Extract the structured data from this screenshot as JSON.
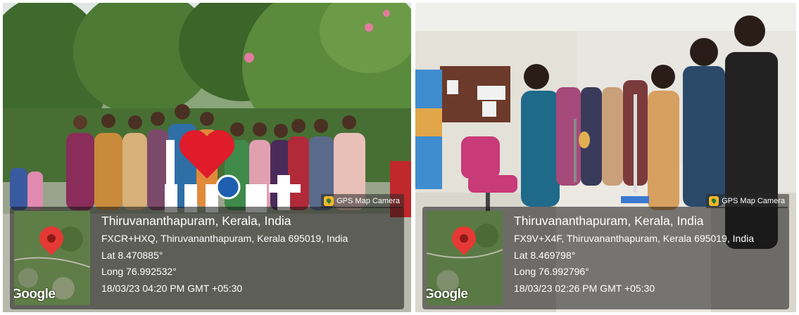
{
  "photos": [
    {
      "badge_label": "GPS Map Camera",
      "map_watermark": "Google",
      "location_title": "Thiruvananthapuram, Kerala, India",
      "address": "FXCR+HXQ, Thiruvananthapuram, Kerala 695019, India",
      "lat": "Lat 8.470885°",
      "long": "Long 76.992532°",
      "datetime": "18/03/23 04:20 PM GMT +05:30",
      "sign_text": "I ♥ IIST"
    },
    {
      "badge_label": "GPS Map Camera",
      "map_watermark": "Google",
      "location_title": "Thiruvananthapuram, Kerala, India",
      "address": "FX9V+X4F, Thiruvananthapuram, Kerala 695019, India",
      "lat": "Lat 8.469798°",
      "long": "Long 76.992796°",
      "datetime": "18/03/23 02:26 PM GMT +05:30"
    }
  ],
  "icons": [
    "gps-map-camera-icon",
    "map-pin-icon"
  ],
  "colors": {
    "overlay": "#141414",
    "pin": "#e53935",
    "badge_icon": "#f3b72b"
  }
}
